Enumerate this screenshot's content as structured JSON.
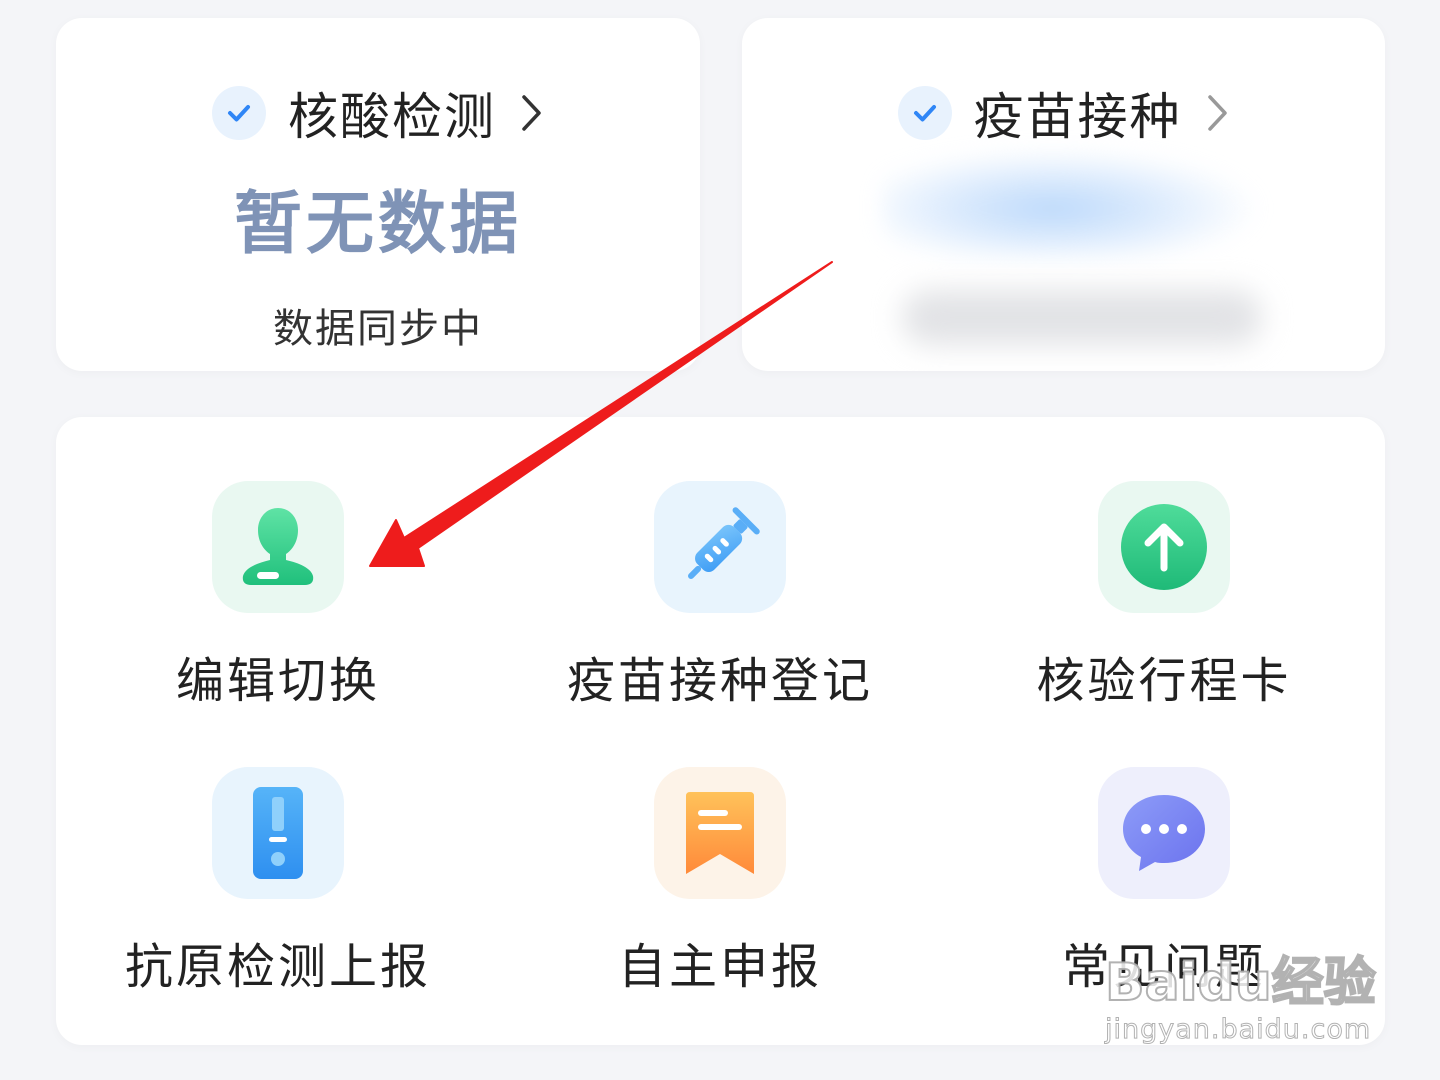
{
  "nat_card": {
    "title": "核酸检测",
    "value": "暂无数据",
    "status": "数据同步中",
    "check_icon": "check-icon",
    "chevron_icon": "chevron-right-icon"
  },
  "vaccine_card": {
    "title": "疫苗接种",
    "check_icon": "check-icon",
    "chevron_icon": "chevron-right-icon"
  },
  "services": [
    {
      "label": "编辑切换",
      "icon": "person-icon"
    },
    {
      "label": "疫苗接种登记",
      "icon": "syringe-icon"
    },
    {
      "label": "核验行程卡",
      "icon": "arrow-up-circle-icon"
    },
    {
      "label": "抗原检测上报",
      "icon": "test-kit-icon"
    },
    {
      "label": "自主申报",
      "icon": "bookmark-icon"
    },
    {
      "label": "常见问题",
      "icon": "chat-bubble-icon"
    }
  ],
  "watermark": {
    "brand": "Baidu经验",
    "url": "jingyan.baidu.com"
  },
  "colors": {
    "accent_blue": "#2f86f6",
    "no_data_text": "#7f93b6",
    "annotation_arrow": "#ee1c1c"
  }
}
